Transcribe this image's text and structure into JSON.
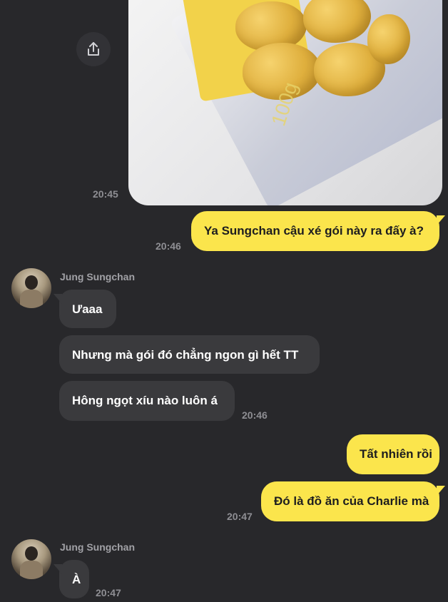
{
  "photo": {
    "times": {
      "sent": "20:45"
    },
    "bag_text": "100g"
  },
  "messages": [
    {
      "id": "m1",
      "text": "Ya Sungchan cậu xé gói này ra đấy à?",
      "time": "20:46"
    },
    {
      "id": "m2",
      "text": "Ưaaa"
    },
    {
      "id": "m3",
      "text": "Nhưng mà gói đó chẳng ngon gì hết TT"
    },
    {
      "id": "m4",
      "text": "Hông ngọt xíu nào luôn á",
      "time": "20:46"
    },
    {
      "id": "m5",
      "text": "Tất nhiên rồi"
    },
    {
      "id": "m6",
      "text": "Đó là đồ ăn của Charlie mà",
      "time": "20:47"
    },
    {
      "id": "m7",
      "text": "À",
      "time": "20:47"
    }
  ],
  "contact": {
    "name": "Jung Sungchan"
  },
  "icons": {
    "share": "share-icon",
    "avatar": "avatar"
  },
  "colors": {
    "background": "#28282b",
    "incoming": "#3a3a3d",
    "outgoing": "#fbe54c"
  }
}
